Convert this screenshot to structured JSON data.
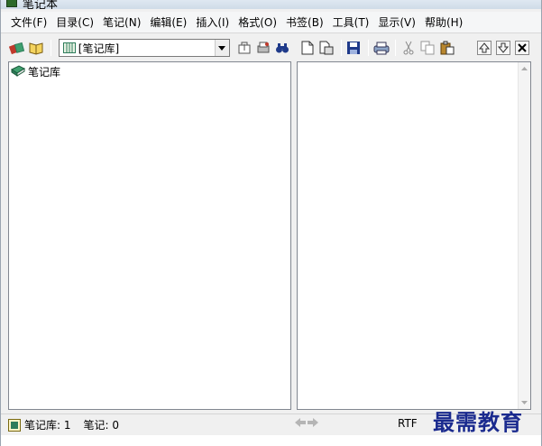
{
  "window": {
    "title": "笔记本"
  },
  "menu": [
    "文件(F)",
    "目录(C)",
    "笔记(N)",
    "编辑(E)",
    "插入(I)",
    "格式(O)",
    "书签(B)",
    "工具(T)",
    "显示(V)",
    "帮助(H)"
  ],
  "library_selector": {
    "value": "[笔记库]"
  },
  "tree": {
    "root_label": "笔记库"
  },
  "status": {
    "library_count": "笔记库: 1",
    "note_count": "笔记: 0",
    "format": "RTF"
  },
  "watermark": "最需教育",
  "colors": {
    "accent": "#1a2a8e",
    "book_green": "#2e7d5b",
    "book_red": "#c0392b"
  }
}
